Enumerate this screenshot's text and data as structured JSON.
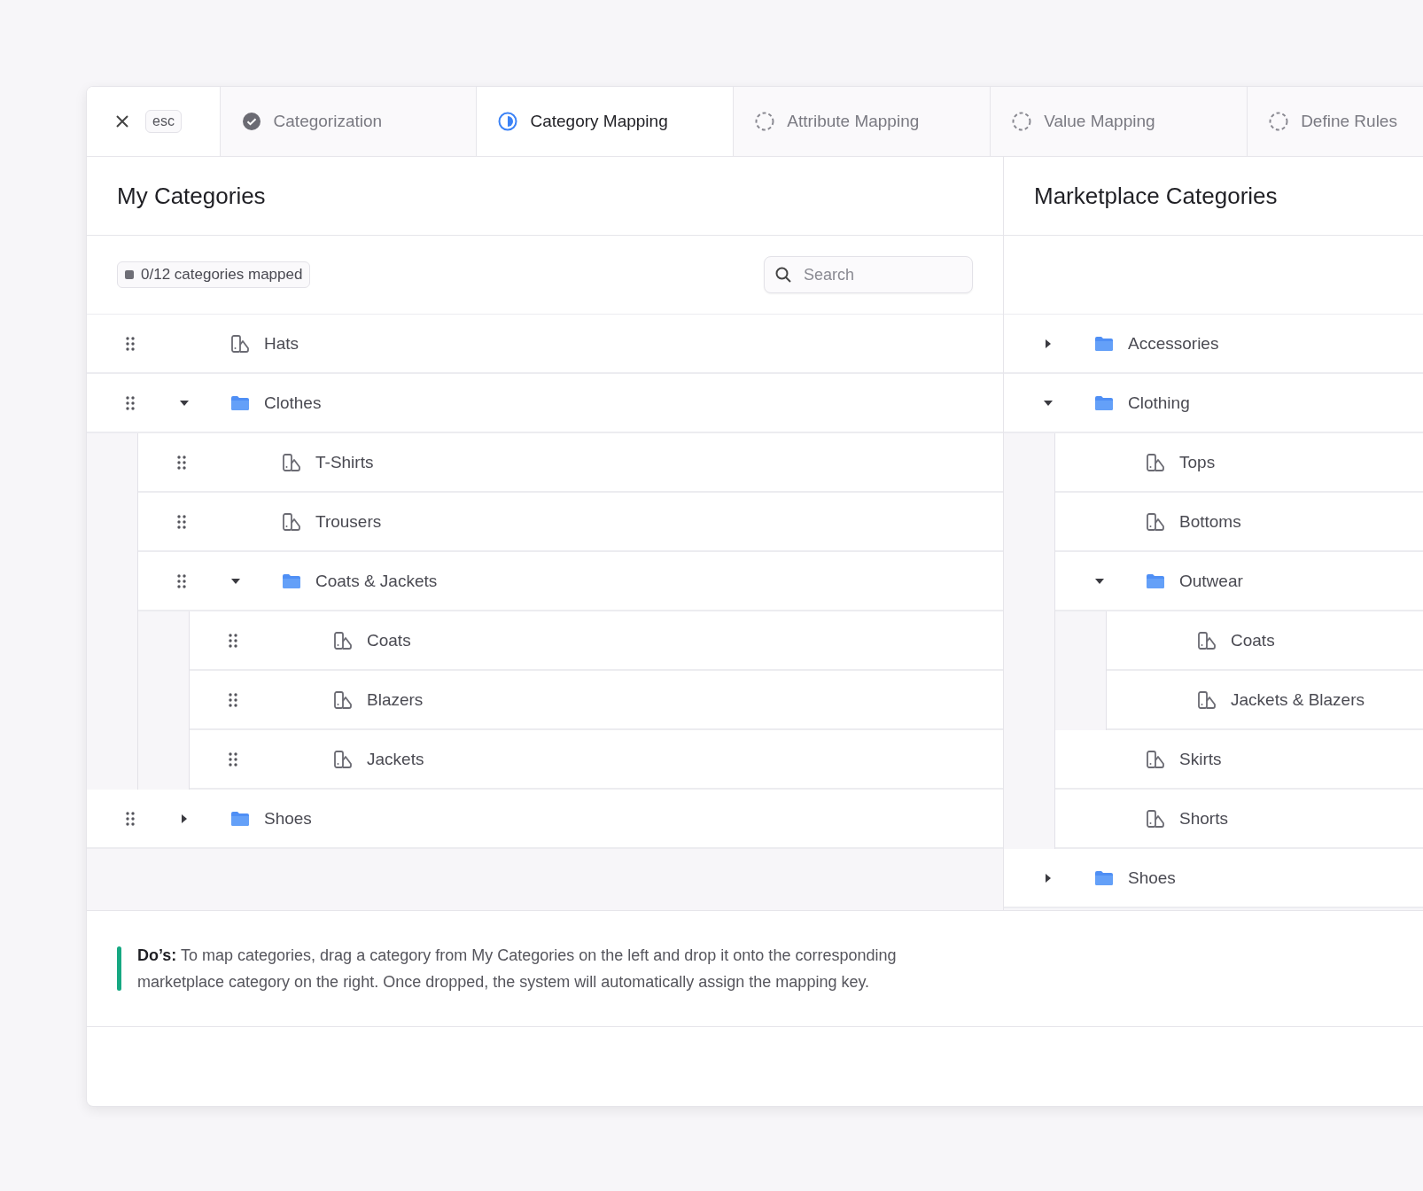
{
  "close": {
    "shortcut": "esc"
  },
  "tabs": [
    {
      "label": "Categorization",
      "kind": "done",
      "selected": false
    },
    {
      "label": "Category Mapping",
      "kind": "current",
      "selected": true
    },
    {
      "label": "Attribute Mapping",
      "kind": "pending",
      "selected": false
    },
    {
      "label": "Value Mapping",
      "kind": "pending",
      "selected": false
    },
    {
      "label": "Define Rules",
      "kind": "pending",
      "selected": false
    }
  ],
  "my_categories": {
    "title": "My Categories",
    "mapped_badge": "0/12 categories mapped",
    "search": {
      "placeholder": "Search"
    },
    "items": [
      {
        "label": "Hats",
        "kind": "leaf"
      },
      {
        "label": "Clothes",
        "kind": "folder",
        "expanded": true,
        "children": [
          {
            "label": "T-Shirts",
            "kind": "leaf"
          },
          {
            "label": "Trousers",
            "kind": "leaf"
          },
          {
            "label": "Coats & Jackets",
            "kind": "folder",
            "expanded": true,
            "children": [
              {
                "label": "Coats",
                "kind": "leaf"
              },
              {
                "label": "Blazers",
                "kind": "leaf"
              },
              {
                "label": "Jackets",
                "kind": "leaf"
              }
            ]
          }
        ]
      },
      {
        "label": "Shoes",
        "kind": "folder",
        "expanded": false
      }
    ]
  },
  "marketplace_categories": {
    "title": "Marketplace Categories",
    "items": [
      {
        "label": "Accessories",
        "kind": "folder",
        "expanded": false
      },
      {
        "label": "Clothing",
        "kind": "folder",
        "expanded": true,
        "children": [
          {
            "label": "Tops",
            "kind": "leaf"
          },
          {
            "label": "Bottoms",
            "kind": "leaf"
          },
          {
            "label": "Outwear",
            "kind": "folder",
            "expanded": true,
            "children": [
              {
                "label": "Coats",
                "kind": "leaf"
              },
              {
                "label": "Jackets & Blazers",
                "kind": "leaf"
              }
            ]
          },
          {
            "label": "Skirts",
            "kind": "leaf"
          },
          {
            "label": "Shorts",
            "kind": "leaf"
          }
        ]
      },
      {
        "label": "Shoes",
        "kind": "folder",
        "expanded": false
      }
    ]
  },
  "hint": {
    "text": "**Do’s:** To map categories, drag a category from My Categories on the left and drop it onto the corresponding marketplace category on the right. Once dropped, the system will automatically assign the mapping key."
  }
}
